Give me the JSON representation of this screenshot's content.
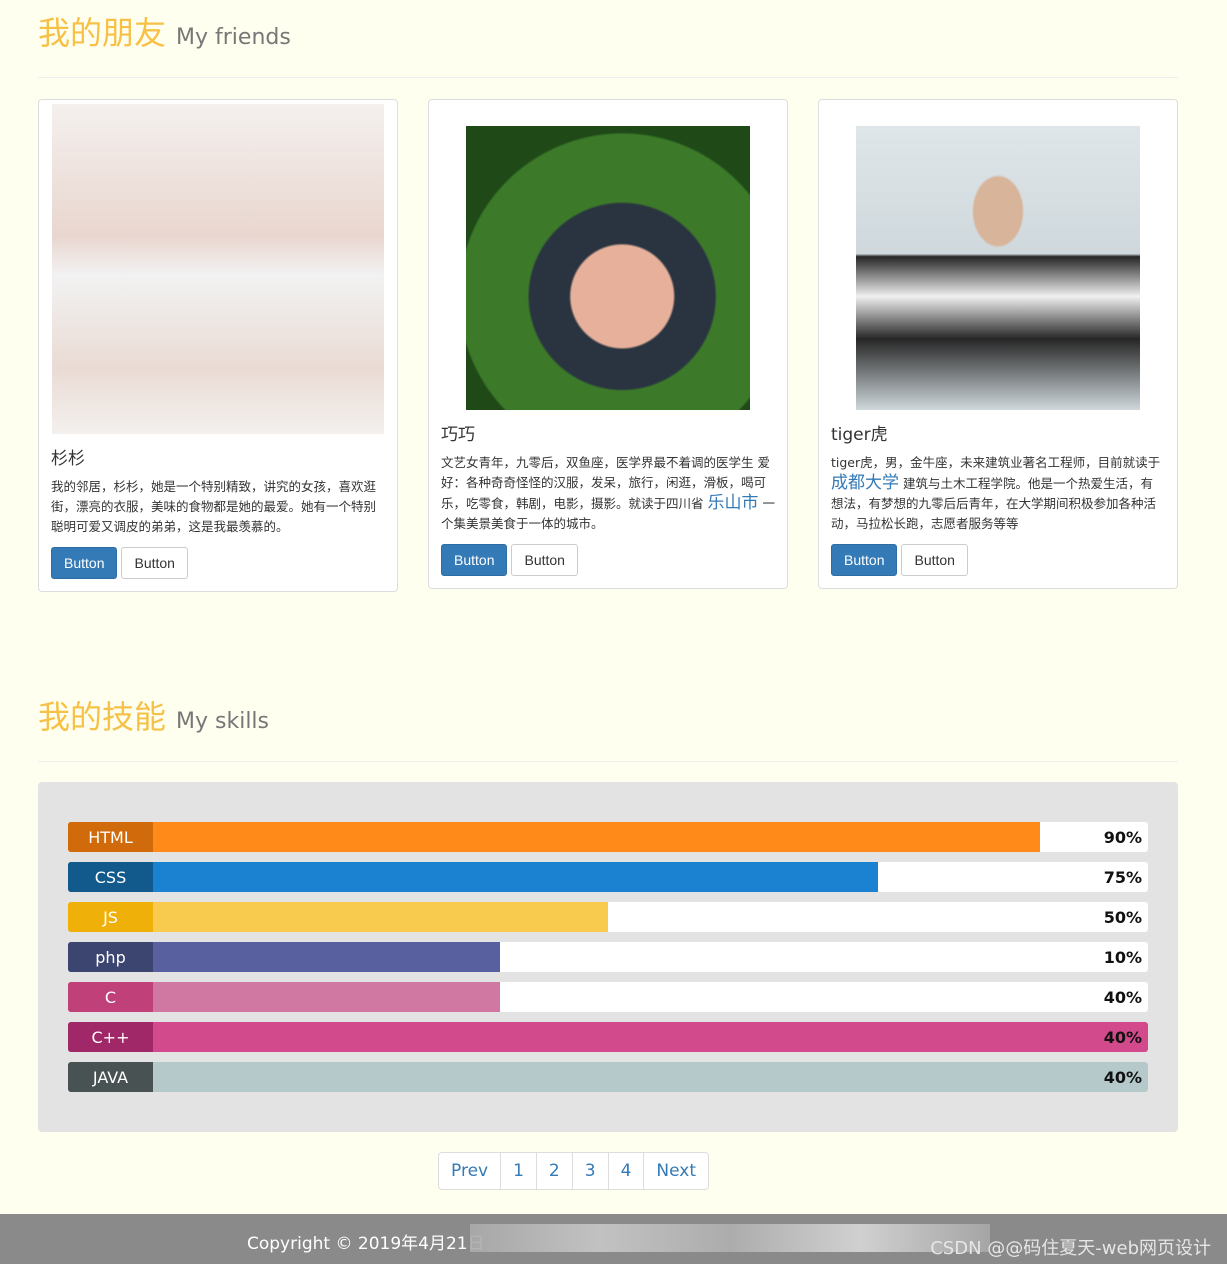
{
  "friends_section": {
    "title_zh": "我的朋友",
    "title_en": "My friends"
  },
  "friends": [
    {
      "name": "杉杉",
      "desc": "我的邻居，杉杉，她是一个特别精致，讲究的女孩，喜欢逛街，漂亮的衣服，美味的食物都是她的最爱。她有一个特别聪明可爱又调皮的弟弟，这是我最羡慕的。",
      "btn_primary": "Button",
      "btn_default": "Button"
    },
    {
      "name": "巧巧",
      "desc_pre": "文艺女青年，九零后，双鱼座，医学界最不着调的医学生 爱好：各种奇奇怪怪的汉服，发呆，旅行，闲逛，滑板，喝可乐，吃零食，韩剧，电影，摄影。就读于四川省",
      "highlight": "乐山市",
      "desc_post": "一个集美景美食于一体的城市。",
      "btn_primary": "Button",
      "btn_default": "Button"
    },
    {
      "name": "tiger虎",
      "desc_pre": "tiger虎，男，金牛座，未来建筑业著名工程师，目前就读于",
      "highlight": "成都大学",
      "desc_post": "建筑与土木工程学院。他是一个热爱生活，有想法，有梦想的九零后后青年，在大学期间积极参加各种活动，马拉松长跑，志愿者服务等等",
      "btn_primary": "Button",
      "btn_default": "Button"
    }
  ],
  "skills_section": {
    "title_zh": "我的技能",
    "title_en": "My skills"
  },
  "skills": [
    {
      "label": "HTML",
      "pct": "90%",
      "fill": 90,
      "dark": "#d06a0a",
      "color": "#ff8a1a"
    },
    {
      "label": "CSS",
      "pct": "75%",
      "fill": 75,
      "dark": "#135a8c",
      "color": "#1a82d0"
    },
    {
      "label": "JS",
      "pct": "50%",
      "fill": 50,
      "dark": "#f0b00a",
      "color": "#f8ca4e"
    },
    {
      "label": "php",
      "pct": "10%",
      "fill": 40,
      "dark": "#3c4570",
      "color": "#5860a0"
    },
    {
      "label": "C",
      "pct": "40%",
      "fill": 40,
      "dark": "#c0407a",
      "color": "#d078a2"
    },
    {
      "label": "C++",
      "pct": "40%",
      "fill": 100,
      "dark": "#a02868",
      "color": "#d24a8c"
    },
    {
      "label": "JAVA",
      "pct": "40%",
      "fill": 100,
      "dark": "#495253",
      "color": "#b5c9ca"
    }
  ],
  "pagination": [
    "Prev",
    "1",
    "2",
    "3",
    "4",
    "Next"
  ],
  "footer": {
    "copyright": "Copyright © 2019年4月21日",
    "watermark": "CSDN @@码住夏天-web网页设计"
  }
}
